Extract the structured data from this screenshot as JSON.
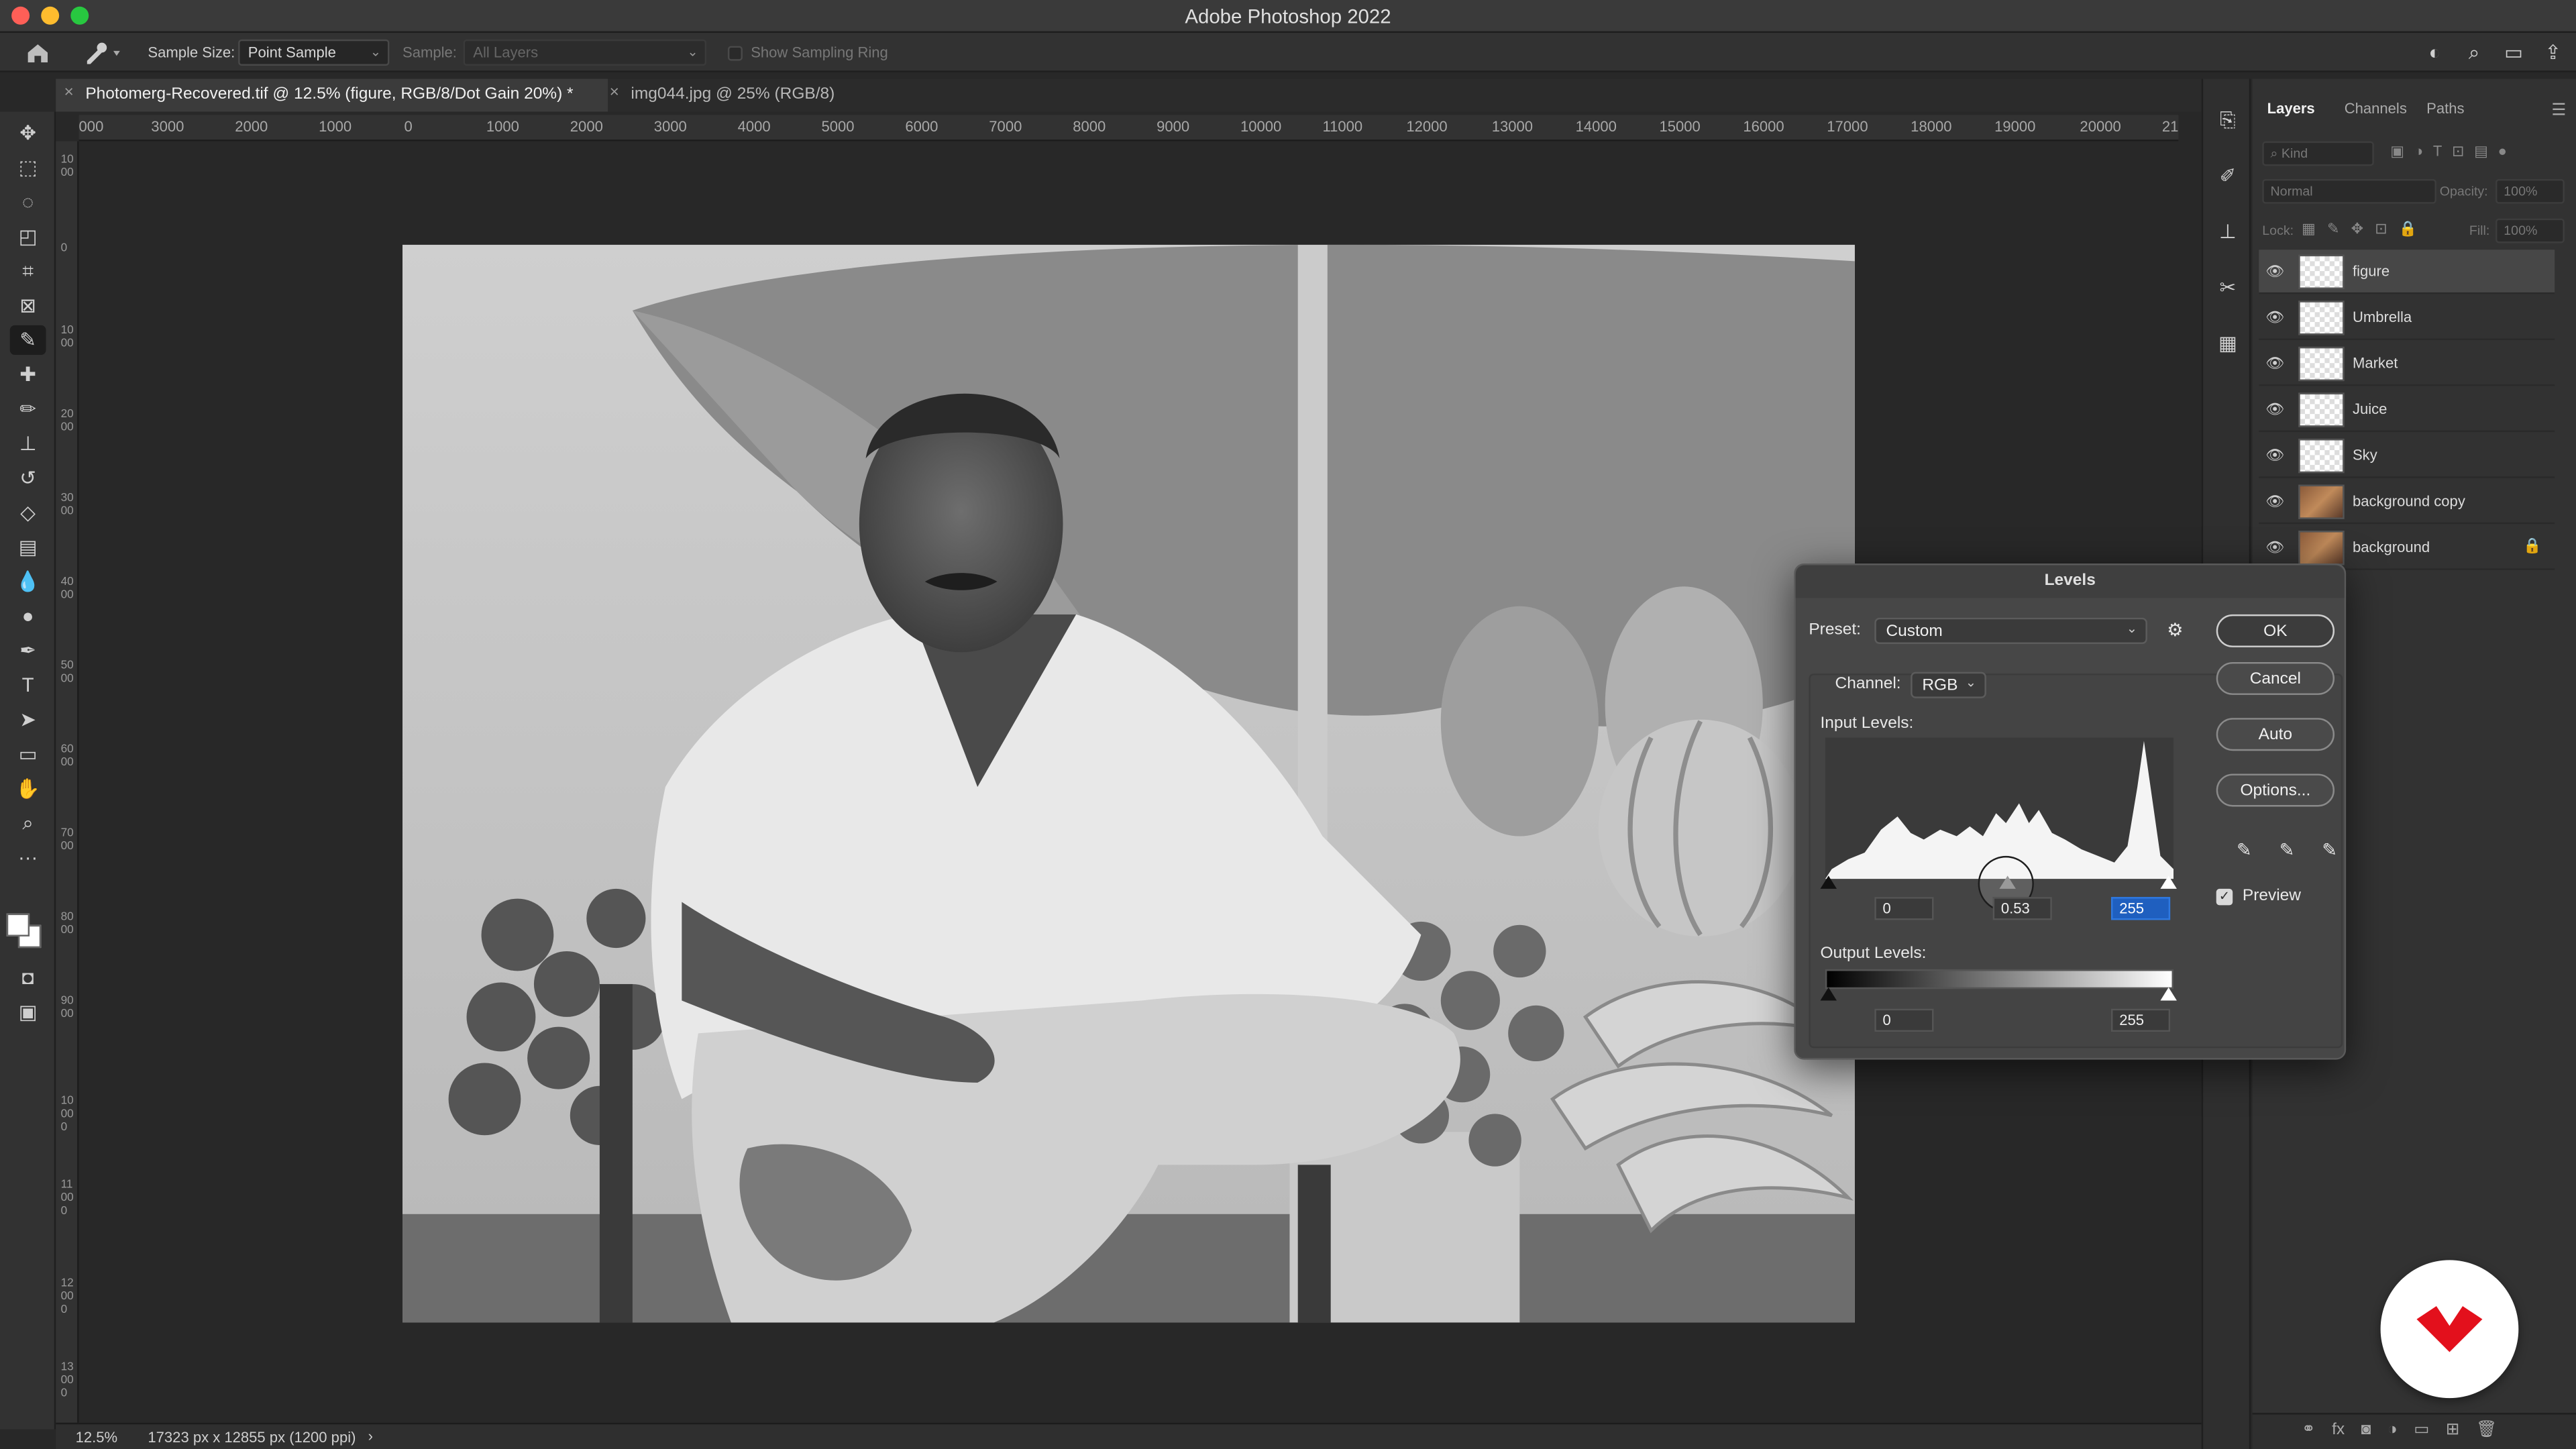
{
  "window": {
    "title": "Adobe Photoshop 2022"
  },
  "options_bar": {
    "sample_size_label": "Sample Size:",
    "sample_size_value": "Point Sample",
    "sample_label": "Sample:",
    "sample_value": "All Layers",
    "show_ring_label": "Show Sampling Ring"
  },
  "tabs": [
    {
      "label": "Photomerg-Recovered.tif @ 12.5% (figure, RGB/8/Dot Gain 20%) *",
      "active": true
    },
    {
      "label": "img044.jpg @ 25% (RGB/8)",
      "active": false
    }
  ],
  "ruler": {
    "h_ticks": [
      "000",
      "3000",
      "2000",
      "1000",
      "0",
      "1000",
      "2000",
      "3000",
      "4000",
      "5000",
      "6000",
      "7000",
      "8000",
      "9000",
      "10000",
      "11000",
      "12000",
      "13000",
      "14000",
      "15000",
      "16000",
      "17000",
      "18000",
      "19000",
      "20000",
      "21"
    ],
    "v_ticks": [
      "1000",
      "0",
      "1000",
      "2000",
      "3000",
      "4000",
      "5000",
      "6000",
      "7000",
      "8000",
      "9000",
      "10000",
      "11000",
      "12000",
      "13000"
    ]
  },
  "status": {
    "zoom": "12.5%",
    "doc_info": "17323 px x 12855 px (1200 ppi)",
    "arrow": "›"
  },
  "layers_panel": {
    "tabs": [
      "Layers",
      "Channels",
      "Paths"
    ],
    "kind_placeholder": "Kind",
    "blend_mode": "Normal",
    "opacity_label": "Opacity:",
    "opacity_value": "100%",
    "lock_label": "Lock:",
    "fill_label": "Fill:",
    "fill_value": "100%",
    "layers": [
      {
        "name": "figure",
        "selected": true,
        "locked": false
      },
      {
        "name": "Umbrella",
        "selected": false,
        "locked": false
      },
      {
        "name": "Market",
        "selected": false,
        "locked": false
      },
      {
        "name": "Juice",
        "selected": false,
        "locked": false
      },
      {
        "name": "Sky",
        "selected": false,
        "locked": false
      },
      {
        "name": "background copy",
        "selected": false,
        "locked": false
      },
      {
        "name": "background",
        "selected": false,
        "locked": true
      }
    ]
  },
  "levels_dialog": {
    "title": "Levels",
    "preset_label": "Preset:",
    "preset_value": "Custom",
    "channel_label": "Channel:",
    "channel_value": "RGB",
    "input_label": "Input Levels:",
    "input_black": "0",
    "input_mid": "0.53",
    "input_white": "255",
    "output_label": "Output Levels:",
    "output_black": "0",
    "output_white": "255",
    "buttons": {
      "ok": "OK",
      "cancel": "Cancel",
      "auto": "Auto",
      "options": "Options..."
    },
    "preview_label": "Preview",
    "preview_checked": true
  },
  "colors": {
    "accent_blue": "#1f5fbf",
    "logo_red": "#e3101c",
    "panel_bg": "#323232"
  }
}
